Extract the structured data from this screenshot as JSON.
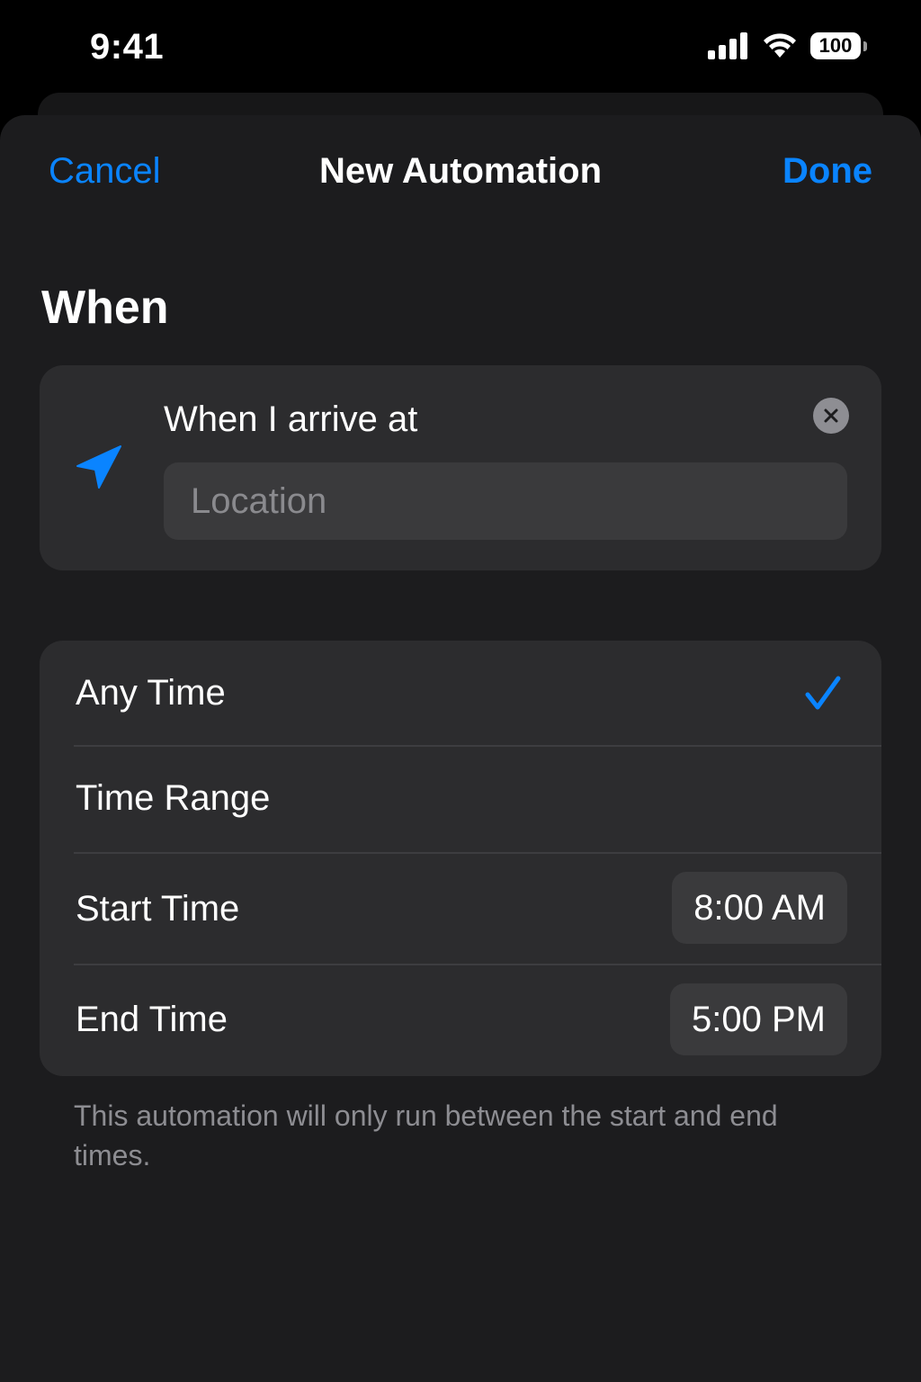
{
  "status_bar": {
    "time": "9:41",
    "battery_level": "100"
  },
  "nav": {
    "cancel_label": "Cancel",
    "title": "New Automation",
    "done_label": "Done"
  },
  "section": {
    "heading": "When"
  },
  "trigger": {
    "label": "When I arrive at",
    "location_placeholder": "Location",
    "location_value": ""
  },
  "time_options": {
    "any_time_label": "Any Time",
    "any_time_selected": true,
    "time_range_label": "Time Range",
    "start_time_label": "Start Time",
    "start_time_value": "8:00 AM",
    "end_time_label": "End Time",
    "end_time_value": "5:00 PM"
  },
  "footnote": "This automation will only run between the start and end times.",
  "colors": {
    "accent": "#0a84ff",
    "background": "#000000",
    "sheet": "#1c1c1e",
    "card": "#2c2c2e",
    "field": "#3a3a3c",
    "secondary_text": "#8d8d92"
  }
}
